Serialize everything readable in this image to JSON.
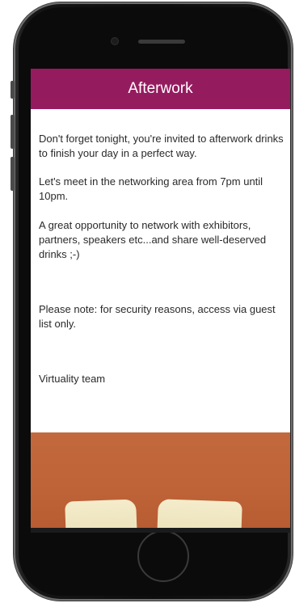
{
  "header": {
    "title": "Afterwork"
  },
  "message": {
    "paragraphs": [
      "Don't forget tonight, you're invited to afterwork drinks to finish your day in a perfect way.",
      "Let's meet in the networking area from 7pm until 10pm.",
      "A great opportunity to network with exhibitors, partners, speakers etc...and share well-deserved drinks ;-)",
      "Please note: for security reasons, access via guest list only.",
      "Virtuality team"
    ]
  },
  "colors": {
    "header_bg": "#951b5f",
    "header_text": "#ffffff",
    "photo_bg": "#c2693d"
  }
}
